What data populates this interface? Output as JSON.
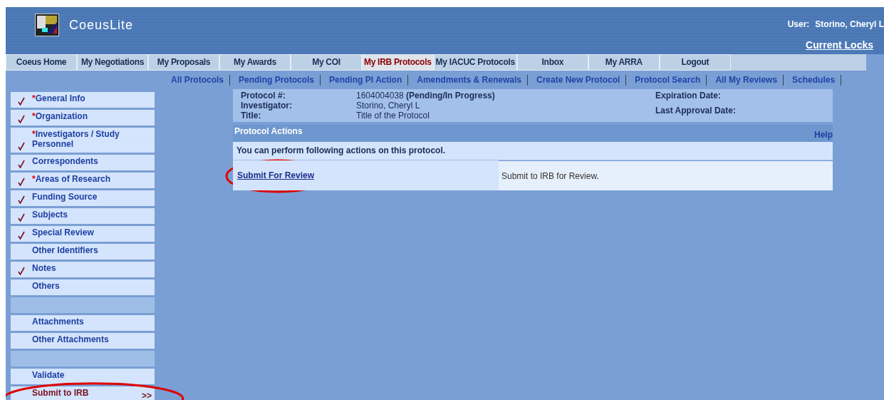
{
  "header": {
    "app_name": "CoeusLite",
    "user_label": "User:",
    "user_name": "Storino, Cheryl L",
    "locks_link": "Current Locks"
  },
  "tabs": [
    {
      "label": "Coeus Home",
      "selected": false
    },
    {
      "label": "My Negotiations",
      "selected": false
    },
    {
      "label": "My Proposals",
      "selected": false
    },
    {
      "label": "My Awards",
      "selected": false
    },
    {
      "label": "My COI",
      "selected": false
    },
    {
      "label": "My IRB Protocols",
      "selected": true
    },
    {
      "label": "My IACUC Protocols",
      "selected": false
    },
    {
      "label": "Inbox",
      "selected": false
    },
    {
      "label": "My ARRA",
      "selected": false
    },
    {
      "label": "Logout",
      "selected": false
    }
  ],
  "sub_links": [
    "All Protocols",
    "Pending Protocols",
    "Pending PI Action",
    "Amendments & Renewals",
    "Create New Protocol",
    "Protocol Search",
    "All My Reviews",
    "Schedules"
  ],
  "sidebar": {
    "items": [
      {
        "kind": "item",
        "required_mark": "*",
        "label": "General Info",
        "checked": true,
        "selected": false
      },
      {
        "kind": "item",
        "required_mark": "*",
        "label": "Organization",
        "checked": true,
        "selected": false
      },
      {
        "kind": "item",
        "required_mark": "*",
        "label": "Investigators / Study Personnel",
        "checked": true,
        "selected": false
      },
      {
        "kind": "item",
        "label": "Correspondents",
        "checked": true,
        "selected": false
      },
      {
        "kind": "item",
        "required_mark": "*",
        "label": "Areas of Research",
        "checked": true,
        "selected": false
      },
      {
        "kind": "item",
        "label": "Funding Source",
        "checked": true,
        "selected": false
      },
      {
        "kind": "item",
        "label": "Subjects",
        "checked": true,
        "selected": false
      },
      {
        "kind": "item",
        "label": "Special Review",
        "checked": true,
        "selected": false
      },
      {
        "kind": "item",
        "label": "Other Identifiers",
        "checked": false,
        "selected": false
      },
      {
        "kind": "item",
        "label": "Notes",
        "checked": true,
        "selected": false
      },
      {
        "kind": "item",
        "label": "Others",
        "checked": false,
        "selected": false
      },
      {
        "kind": "spacer"
      },
      {
        "kind": "item",
        "label": "Attachments",
        "checked": false,
        "selected": false
      },
      {
        "kind": "item",
        "label": "Other Attachments",
        "checked": false,
        "selected": false
      },
      {
        "kind": "spacer"
      },
      {
        "kind": "item",
        "label": "Validate",
        "checked": false,
        "selected": false
      },
      {
        "kind": "item",
        "label": "Submit to IRB",
        "checked": false,
        "selected": true,
        "highlight": true,
        "marker": ">>"
      }
    ]
  },
  "protocol": {
    "fields_left": [
      {
        "label": "Protocol #:",
        "value": "1604004038 **(Pending/In Progress)**"
      },
      {
        "label": "Investigator:",
        "value": "Storino, Cheryl L"
      },
      {
        "label": "Title:",
        "value": "Title of the Protocol"
      }
    ],
    "fields_right": [
      {
        "label": "Expiration Date:"
      },
      {
        "label": "Last Approval Date:"
      }
    ]
  },
  "actions_panel": {
    "title": "Protocol Actions",
    "help": "Help",
    "intro": "You can perform following actions on this protocol.",
    "actions": [
      {
        "link": "Submit For Review",
        "description": "Submit to IRB for Review.",
        "highlight": true
      }
    ]
  }
}
